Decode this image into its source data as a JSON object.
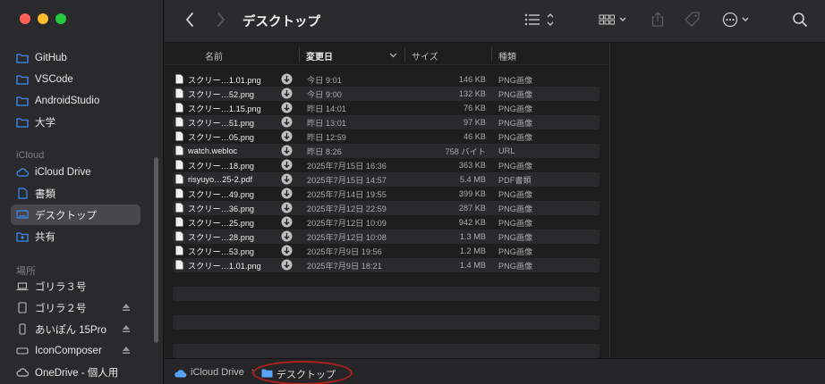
{
  "window": {
    "title": "デスクトップ"
  },
  "sidebar": {
    "favorites": [
      {
        "label": "GitHub",
        "icon": "folder-icon"
      },
      {
        "label": "VSCode",
        "icon": "folder-icon"
      },
      {
        "label": "AndroidStudio",
        "icon": "folder-icon"
      },
      {
        "label": "大学",
        "icon": "folder-icon"
      }
    ],
    "icloud_header": "iCloud",
    "icloud": [
      {
        "label": "iCloud Drive",
        "icon": "cloud-icon"
      },
      {
        "label": "書類",
        "icon": "document-icon"
      },
      {
        "label": "デスクトップ",
        "icon": "desktop-icon",
        "selected": true
      },
      {
        "label": "共有",
        "icon": "shared-folder-icon"
      }
    ],
    "locations_header": "場所",
    "locations": [
      {
        "label": "ゴリラ３号",
        "icon": "laptop-icon"
      },
      {
        "label": "ゴリラ２号",
        "icon": "ipad-icon",
        "eject": true
      },
      {
        "label": "あいぽん 15Pro",
        "icon": "iphone-icon",
        "eject": true
      },
      {
        "label": "IconComposer",
        "icon": "disk-icon",
        "eject": true
      },
      {
        "label": "OneDrive - 個人用",
        "icon": "cloud-icon"
      }
    ]
  },
  "columns": {
    "name": "名前",
    "date": "変更日",
    "size": "サイズ",
    "kind": "種類"
  },
  "files": [
    {
      "name": "スクリー…1.01.png",
      "date": "今日 9:01",
      "size": "146 KB",
      "kind": "PNG画像"
    },
    {
      "name": "スクリー…52.png",
      "date": "今日 9:00",
      "size": "132 KB",
      "kind": "PNG画像"
    },
    {
      "name": "スクリー…1.15.png",
      "date": "昨日 14:01",
      "size": "76 KB",
      "kind": "PNG画像"
    },
    {
      "name": "スクリー…51.png",
      "date": "昨日 13:01",
      "size": "97 KB",
      "kind": "PNG画像"
    },
    {
      "name": "スクリー…05.png",
      "date": "昨日 12:59",
      "size": "46 KB",
      "kind": "PNG画像"
    },
    {
      "name": "watch.webloc",
      "date": "昨日 8:26",
      "size": "758 バイト",
      "kind": "URL"
    },
    {
      "name": "スクリー…18.png",
      "date": "2025年7月15日 16:36",
      "size": "363 KB",
      "kind": "PNG画像"
    },
    {
      "name": "risyuyo…25-2.pdf",
      "date": "2025年7月15日 14:57",
      "size": "5.4 MB",
      "kind": "PDF書類"
    },
    {
      "name": "スクリー…49.png",
      "date": "2025年7月14日 19:55",
      "size": "399 KB",
      "kind": "PNG画像"
    },
    {
      "name": "スクリー…36.png",
      "date": "2025年7月12日 22:59",
      "size": "287 KB",
      "kind": "PNG画像"
    },
    {
      "name": "スクリー…25.png",
      "date": "2025年7月12日 10:09",
      "size": "942 KB",
      "kind": "PNG画像"
    },
    {
      "name": "スクリー…28.png",
      "date": "2025年7月12日 10:08",
      "size": "1.3 MB",
      "kind": "PNG画像"
    },
    {
      "name": "スクリー…53.png",
      "date": "2025年7月9日 19:56",
      "size": "1.2 MB",
      "kind": "PNG画像"
    },
    {
      "name": "スクリー…1.01.png",
      "date": "2025年7月9日 18:21",
      "size": "1.4 MB",
      "kind": "PNG画像"
    }
  ],
  "pathbar": {
    "items": [
      "iCloud Drive",
      "デスクトップ"
    ],
    "separator": "›"
  },
  "colors": {
    "accent": "#3b8cf6",
    "annotation": "#b0201c",
    "selected": "#48484a"
  }
}
